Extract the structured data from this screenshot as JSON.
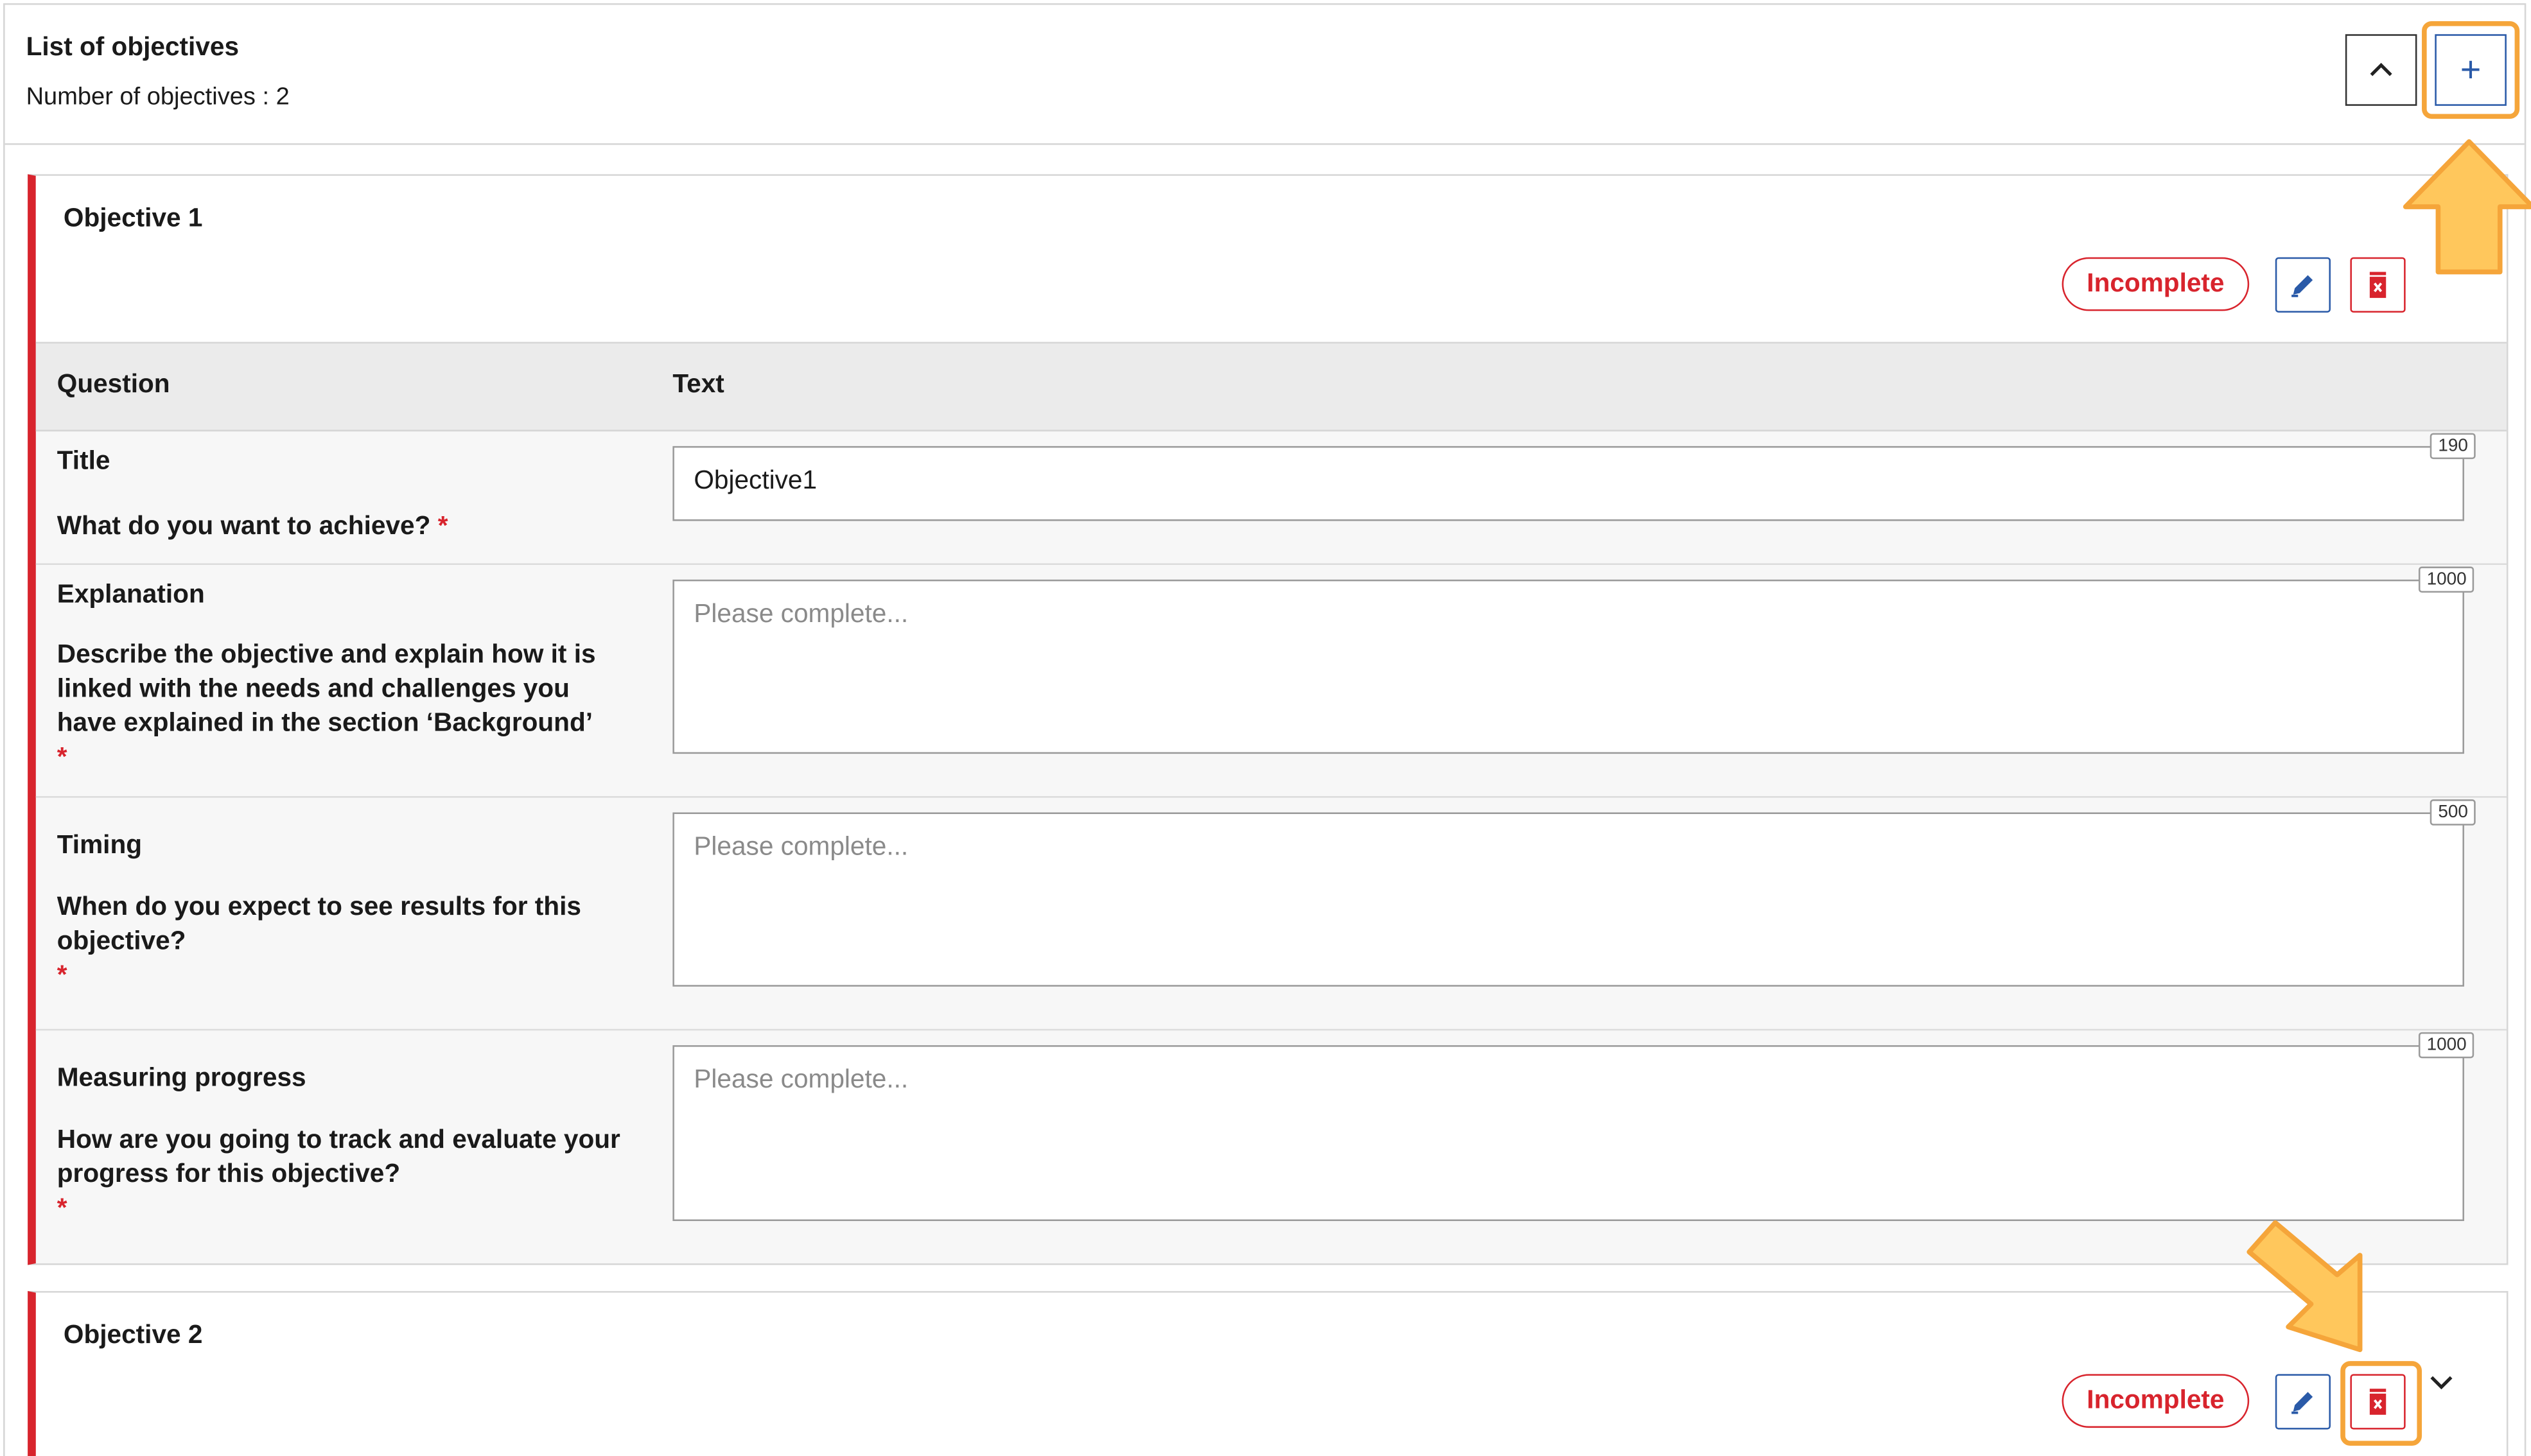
{
  "list": {
    "title": "List of objectives",
    "count_text": "Number of objectives : 2",
    "collapse_icon": "chevron-up-icon",
    "add_icon": "plus-icon",
    "add_symbol": "+"
  },
  "objectives": [
    {
      "title": "Objective 1",
      "status": "Incomplete",
      "table": {
        "columns": [
          "Question",
          "Text"
        ],
        "rows": [
          {
            "label": "Title",
            "question": "What do you want to achieve?",
            "required_mark": "*",
            "value": "Objective1",
            "placeholder": "",
            "max_chars": "190"
          },
          {
            "label": "Explanation",
            "question": "Describe the objective and explain how it is linked with the needs and challenges you have explained in the section ‘Background’",
            "required_mark": "*",
            "value": "",
            "placeholder": "Please complete...",
            "max_chars": "1000"
          },
          {
            "label": "Timing",
            "question": "When do you expect to see results for this objective?",
            "required_mark": "*",
            "value": "",
            "placeholder": "Please complete...",
            "max_chars": "500"
          },
          {
            "label": "Measuring progress",
            "question": "How are you going to track and evaluate your progress for this objective?",
            "required_mark": "*",
            "value": "",
            "placeholder": "Please complete...",
            "max_chars": "1000"
          }
        ]
      }
    },
    {
      "title": "Objective 2",
      "status": "Incomplete",
      "expand_icon": "chevron-down-icon"
    }
  ],
  "colors": {
    "accent_blue": "#2a5aa8",
    "error_red": "#d8242d",
    "highlight_orange": "#f5a53a",
    "arrow_fill": "#ffc75c"
  },
  "icons": {
    "edit": "pencil-icon",
    "delete": "trash-icon",
    "annotation": "arrow-icon"
  }
}
